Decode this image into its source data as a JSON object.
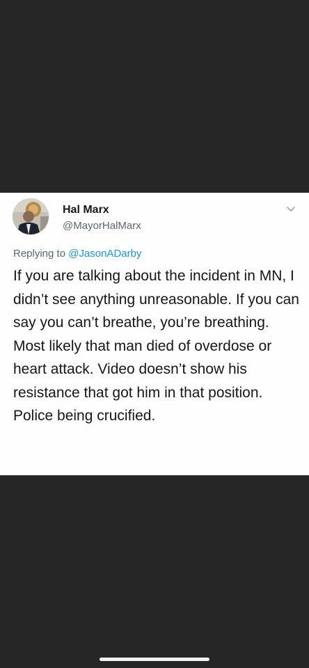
{
  "tweet": {
    "author_name": "Hal Marx",
    "author_handle": "@MayorHalMarx",
    "reply_prefix": "Replying to",
    "reply_handle": "@JasonADarby",
    "text": "If you are talking about the incident in MN, I didn’t see anything unreasonable. If you can say you can’t breathe, you’re breathing. Most likely that man died of overdose or heart attack. Video doesn’t show his resistance that got him in that position. Police being crucified.",
    "avatar_icon": "profile-photo",
    "menu_icon": "chevron-down-icon"
  },
  "colors": {
    "background": "#262626",
    "card": "#fefefe",
    "text": "#14171a",
    "secondary_text": "#5b6670",
    "link": "#1b95e0"
  }
}
